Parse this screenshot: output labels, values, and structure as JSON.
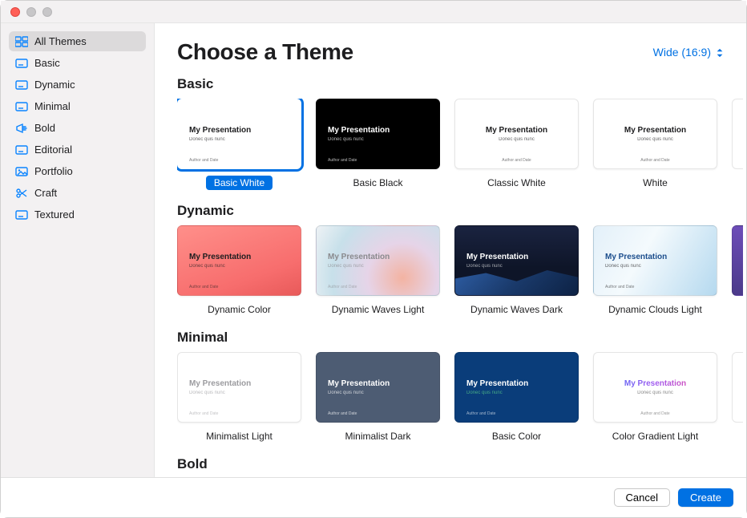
{
  "header": {
    "title": "Choose a Theme",
    "aspect_label": "Wide (16:9)"
  },
  "sidebar": {
    "items": [
      {
        "label": "All Themes",
        "icon": "grid-icon",
        "selected": true
      },
      {
        "label": "Basic",
        "icon": "slide-icon",
        "selected": false
      },
      {
        "label": "Dynamic",
        "icon": "slide-icon",
        "selected": false
      },
      {
        "label": "Minimal",
        "icon": "slide-icon",
        "selected": false
      },
      {
        "label": "Bold",
        "icon": "megaphone-icon",
        "selected": false
      },
      {
        "label": "Editorial",
        "icon": "slide-icon",
        "selected": false
      },
      {
        "label": "Portfolio",
        "icon": "photo-icon",
        "selected": false
      },
      {
        "label": "Craft",
        "icon": "scissors-icon",
        "selected": false
      },
      {
        "label": "Textured",
        "icon": "slide-icon",
        "selected": false
      }
    ]
  },
  "thumb_text": {
    "title": "My Presentation",
    "subtitle": "Donec quis nunc",
    "author": "Author and Date"
  },
  "sections": [
    {
      "title": "Basic",
      "themes": [
        {
          "name": "Basic White",
          "style": "bg-white",
          "align": "left",
          "selected": true
        },
        {
          "name": "Basic Black",
          "style": "bg-black",
          "align": "left",
          "selected": false
        },
        {
          "name": "Classic White",
          "style": "bg-white center",
          "align": "center",
          "selected": false
        },
        {
          "name": "White",
          "style": "bg-white center",
          "align": "center",
          "selected": false
        }
      ],
      "sliver_style": "bg-white"
    },
    {
      "title": "Dynamic",
      "themes": [
        {
          "name": "Dynamic Color",
          "style": "bg-dyn-color",
          "align": "left",
          "selected": false
        },
        {
          "name": "Dynamic Waves Light",
          "style": "bg-dyn-wl",
          "align": "left",
          "selected": false
        },
        {
          "name": "Dynamic Waves Dark",
          "style": "bg-dyn-wd",
          "align": "left",
          "selected": false
        },
        {
          "name": "Dynamic Clouds Light",
          "style": "bg-dyn-cl",
          "align": "left",
          "selected": false
        }
      ],
      "sliver_style": "bg-dyn-sliver"
    },
    {
      "title": "Minimal",
      "themes": [
        {
          "name": "Minimalist Light",
          "style": "bg-min-l",
          "align": "left",
          "selected": false
        },
        {
          "name": "Minimalist Dark",
          "style": "bg-min-d",
          "align": "left",
          "selected": false
        },
        {
          "name": "Basic Color",
          "style": "bg-basic-color",
          "align": "left",
          "selected": false
        },
        {
          "name": "Color Gradient Light",
          "style": "bg-grad-l center",
          "align": "center",
          "selected": false
        }
      ],
      "sliver_style": "bg-white"
    },
    {
      "title": "Bold",
      "themes": []
    }
  ],
  "footer": {
    "cancel_label": "Cancel",
    "create_label": "Create"
  }
}
